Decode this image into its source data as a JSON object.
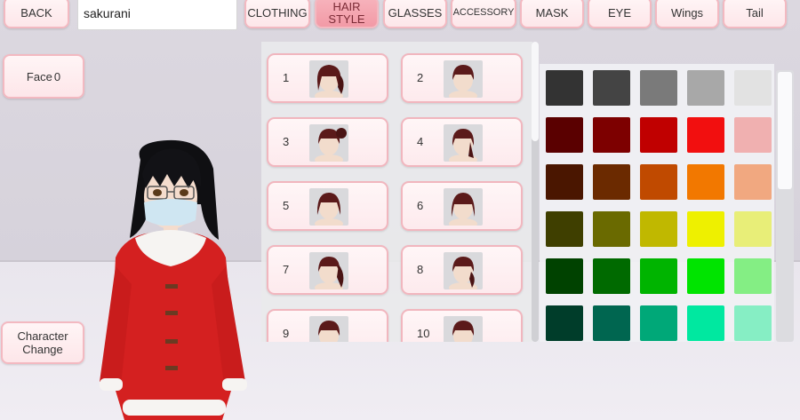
{
  "top_bar": {
    "back_label": "BACK",
    "name_value": "sakurani",
    "tabs": [
      {
        "label": "CLOTHING"
      },
      {
        "label": "HAIR\nSTYLE",
        "active": true
      },
      {
        "label": "GLASSES"
      },
      {
        "label": "ACCESSORY"
      },
      {
        "label": "MASK"
      },
      {
        "label": "EYE"
      },
      {
        "label": "Wings"
      },
      {
        "label": "Tail"
      }
    ]
  },
  "face_button": {
    "label": "Face",
    "value": "0"
  },
  "character_change": {
    "label_line1": "Character",
    "label_line2": "Change"
  },
  "hair_styles": [
    {
      "number": "1"
    },
    {
      "number": "2"
    },
    {
      "number": "3"
    },
    {
      "number": "4"
    },
    {
      "number": "5"
    },
    {
      "number": "6"
    },
    {
      "number": "7"
    },
    {
      "number": "8"
    },
    {
      "number": "9"
    },
    {
      "number": "10"
    }
  ],
  "palette": {
    "rows": [
      [
        "#333333",
        "#444444",
        "#7a7a7a",
        "#a8a8a8",
        "#e2e2e2"
      ],
      [
        "#5a0000",
        "#7d0000",
        "#c00000",
        "#f20f0f",
        "#f0b0b0"
      ],
      [
        "#4a1600",
        "#6b2a00",
        "#c04a00",
        "#f27800",
        "#f1a880"
      ],
      [
        "#3f3f00",
        "#6a6a00",
        "#c0b800",
        "#eef000",
        "#e8ee78"
      ],
      [
        "#004200",
        "#006a00",
        "#00b400",
        "#00e400",
        "#84ee84"
      ],
      [
        "#003d2a",
        "#006650",
        "#00a878",
        "#00e8a0",
        "#86eec4"
      ]
    ]
  },
  "colors": {
    "accent": "#f29aa6",
    "border": "#f1b6be",
    "hair": "#5b1a1a",
    "coat": "#d42020"
  }
}
